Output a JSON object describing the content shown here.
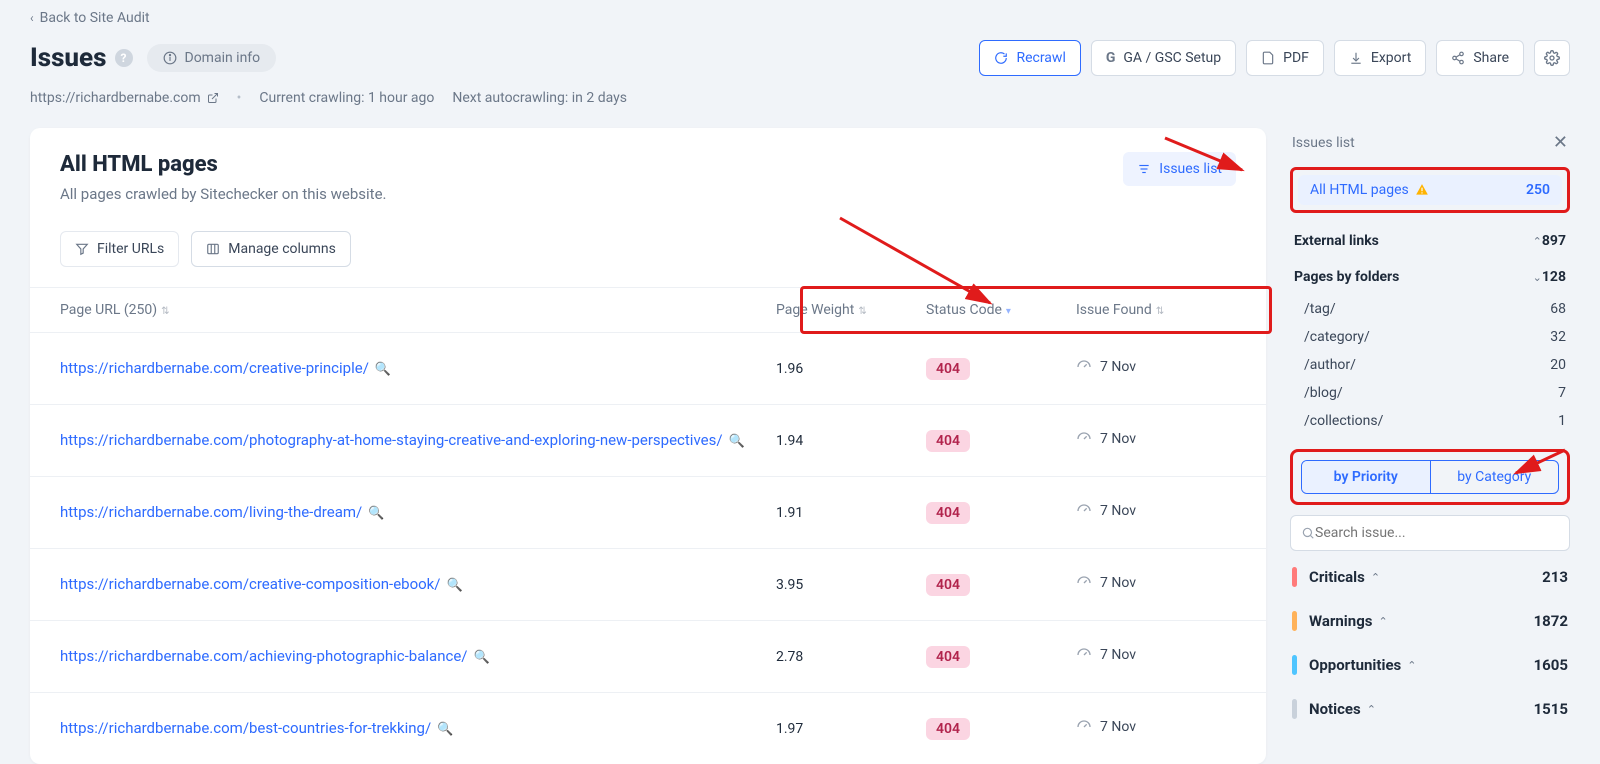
{
  "back_link": "Back to Site Audit",
  "page_title": "Issues",
  "domain_info_label": "Domain info",
  "header_buttons": {
    "recrawl": "Recrawl",
    "ga_gsc": "GA / GSC Setup",
    "pdf": "PDF",
    "export": "Export",
    "share": "Share"
  },
  "site_url": "https://richardbernabe.com",
  "current_crawling": "Current crawling: 1 hour ago",
  "next_autocrawl": "Next autocrawling: in 2 days",
  "section": {
    "title": "All HTML pages",
    "desc": "All pages crawled by Sitechecker on this website.",
    "issues_list_btn": "Issues list"
  },
  "toolbar": {
    "filter": "Filter URLs",
    "manage_columns": "Manage columns"
  },
  "columns": {
    "page_url": "Page URL (250)",
    "weight": "Page Weight",
    "status": "Status Code",
    "issue": "Issue Found"
  },
  "rows": [
    {
      "url": "https://richardbernabe.com/creative-principle/",
      "weight": "1.96",
      "status": "404",
      "issue": "7 Nov"
    },
    {
      "url": "https://richardbernabe.com/photography-at-home-staying-creative-and-exploring-new-perspectives/",
      "weight": "1.94",
      "status": "404",
      "issue": "7 Nov"
    },
    {
      "url": "https://richardbernabe.com/living-the-dream/",
      "weight": "1.91",
      "status": "404",
      "issue": "7 Nov"
    },
    {
      "url": "https://richardbernabe.com/creative-composition-ebook/",
      "weight": "3.95",
      "status": "404",
      "issue": "7 Nov"
    },
    {
      "url": "https://richardbernabe.com/achieving-photographic-balance/",
      "weight": "2.78",
      "status": "404",
      "issue": "7 Nov"
    },
    {
      "url": "https://richardbernabe.com/best-countries-for-trekking/",
      "weight": "1.97",
      "status": "404",
      "issue": "7 Nov"
    }
  ],
  "sidebar": {
    "title": "Issues list",
    "all_html_pages": {
      "label": "All HTML pages",
      "count": "250"
    },
    "external_links": {
      "label": "External links",
      "count": "897"
    },
    "pages_by_folders": {
      "label": "Pages by folders",
      "count": "128"
    },
    "folders": [
      {
        "label": "/tag/",
        "count": "68"
      },
      {
        "label": "/category/",
        "count": "32"
      },
      {
        "label": "/author/",
        "count": "20"
      },
      {
        "label": "/blog/",
        "count": "7"
      },
      {
        "label": "/collections/",
        "count": "1"
      }
    ],
    "tabs": {
      "priority": "by Priority",
      "category": "by Category"
    },
    "search_placeholder": "Search issue...",
    "categories": [
      {
        "label": "Criticals",
        "count": "213",
        "color": "#ff7a7a"
      },
      {
        "label": "Warnings",
        "count": "1872",
        "color": "#ffb25a"
      },
      {
        "label": "Opportunities",
        "count": "1605",
        "color": "#4fc5ff"
      },
      {
        "label": "Notices",
        "count": "1515",
        "color": "#c9d1db"
      }
    ]
  }
}
